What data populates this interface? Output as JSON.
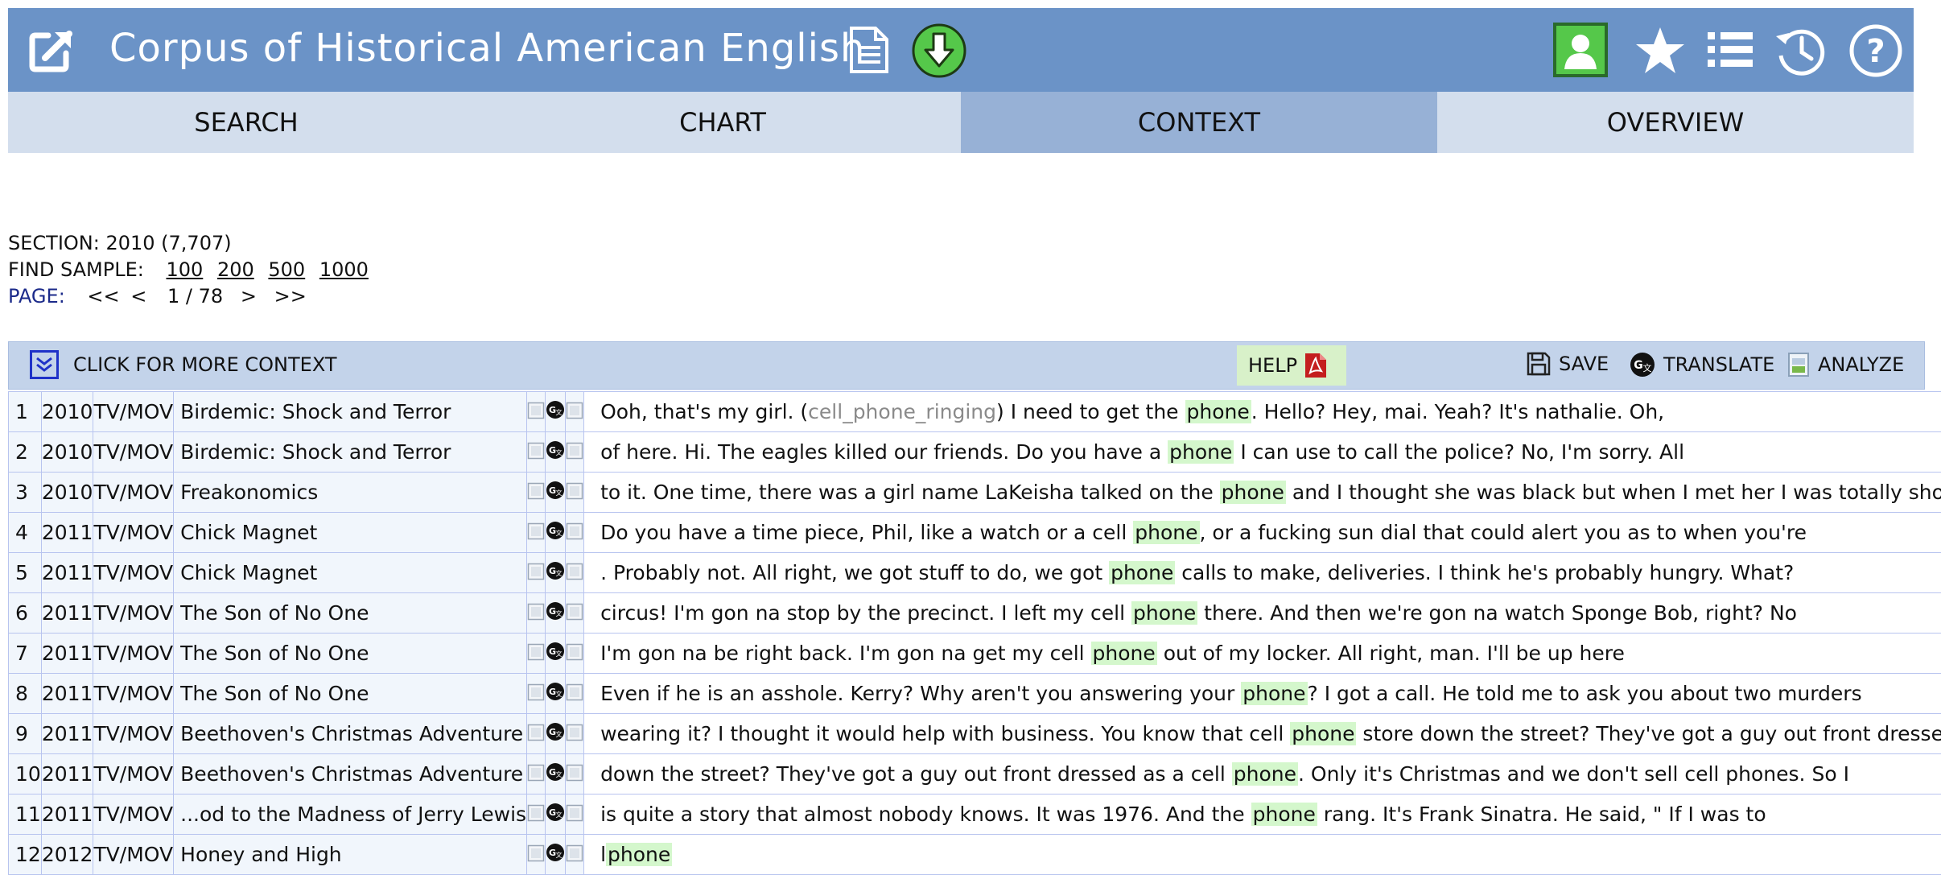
{
  "app": {
    "title": "Corpus of Historical American English"
  },
  "tabs": [
    {
      "label": "SEARCH"
    },
    {
      "label": "CHART"
    },
    {
      "label": "CONTEXT"
    },
    {
      "label": "OVERVIEW"
    }
  ],
  "active_tab": "CONTEXT",
  "info": {
    "section": "SECTION: 2010 (7,707)",
    "find_sample_label": "FIND SAMPLE:",
    "samples": [
      "100",
      "200",
      "500",
      "1000"
    ],
    "page_label": "PAGE:",
    "page_first": "<<",
    "page_prev": "<",
    "page_indicator": "1 / 78",
    "page_next": ">",
    "page_last": ">>"
  },
  "toolbar": {
    "more_context": "CLICK FOR MORE CONTEXT",
    "help": "HELP",
    "save": "SAVE",
    "translate": "TRANSLATE",
    "analyze": "ANALYZE"
  },
  "colors": {
    "header_bg": "#6b93c7",
    "tab_bg": "#d3deed",
    "tab_active_bg": "#97b1d6",
    "keyword_highlight": "#d4f7cc",
    "download_green": "#55c84a"
  },
  "icons": [
    "external-link-icon",
    "document-icon",
    "download-icon",
    "user-icon",
    "star-icon",
    "list-icon",
    "history-icon",
    "help-circle-icon"
  ],
  "rows": [
    {
      "num": "1",
      "year": "2010",
      "genre": "TV/MOV",
      "source": "Birdemic: Shock and Terror",
      "pre": "Ooh, that's my girl. (",
      "aside": "cell_phone_ringing",
      "pre2": ") I need to get the ",
      "kw": "phone",
      "post": ". Hello? Hey, mai. Yeah? It's nathalie. Oh,"
    },
    {
      "num": "2",
      "year": "2010",
      "genre": "TV/MOV",
      "source": "Birdemic: Shock and Terror",
      "pre": "of here. Hi. The eagles killed our friends. Do you have a ",
      "kw": "phone",
      "post": " I can use to call the police? No, I'm sorry. All"
    },
    {
      "num": "3",
      "year": "2010",
      "genre": "TV/MOV",
      "source": "Freakonomics",
      "pre": "to it. One time, there was a girl name LaKeisha talked on the ",
      "kw": "phone",
      "post": " and I thought she was black but when I met her I was totally shocked"
    },
    {
      "num": "4",
      "year": "2011",
      "genre": "TV/MOV",
      "source": "Chick Magnet",
      "pre": "Do you have a time piece, Phil, like a watch or a cell ",
      "kw": "phone",
      "post": ", or a fucking sun dial that could alert you as to when you're"
    },
    {
      "num": "5",
      "year": "2011",
      "genre": "TV/MOV",
      "source": "Chick Magnet",
      "pre": ". Probably not. All right, we got stuff to do, we got ",
      "kw": "phone",
      "post": " calls to make, deliveries. I think he's probably hungry. What?"
    },
    {
      "num": "6",
      "year": "2011",
      "genre": "TV/MOV",
      "source": "The Son of No One",
      "pre": "circus! I'm gon na stop by the precinct. I left my cell ",
      "kw": "phone",
      "post": " there. And then we're gon na watch Sponge Bob, right? No"
    },
    {
      "num": "7",
      "year": "2011",
      "genre": "TV/MOV",
      "source": "The Son of No One",
      "pre": "I'm gon na be right back. I'm gon na get my cell ",
      "kw": "phone",
      "post": " out of my locker. All right, man. I'll be up here"
    },
    {
      "num": "8",
      "year": "2011",
      "genre": "TV/MOV",
      "source": "The Son of No One",
      "pre": "Even if he is an asshole. Kerry? Why aren't you answering your ",
      "kw": "phone",
      "post": "? I got a call. He told me to ask you about two murders"
    },
    {
      "num": "9",
      "year": "2011",
      "genre": "TV/MOV",
      "source": "Beethoven's Christmas Adventure",
      "pre": "wearing it? I thought it would help with business. You know that cell ",
      "kw": "phone",
      "post": " store down the street? They've got a guy out front dressed as a"
    },
    {
      "num": "10",
      "year": "2011",
      "genre": "TV/MOV",
      "source": "Beethoven's Christmas Adventure",
      "pre": "down the street? They've got a guy out front dressed as a cell ",
      "kw": "phone",
      "post": ". Only it's Christmas and we don't sell cell phones. So I"
    },
    {
      "num": "11",
      "year": "2011",
      "genre": "TV/MOV",
      "source": "...od to the Madness of Jerry Lewis",
      "pre": "is quite a story that almost nobody knows. It was 1976. And the ",
      "kw": "phone",
      "post": " rang. It's Frank Sinatra. He said, \" If I was to"
    },
    {
      "num": "12",
      "year": "2012",
      "genre": "TV/MOV",
      "source": "Honey and High",
      "pre": "l",
      "kw": "phone",
      "post": ""
    }
  ]
}
